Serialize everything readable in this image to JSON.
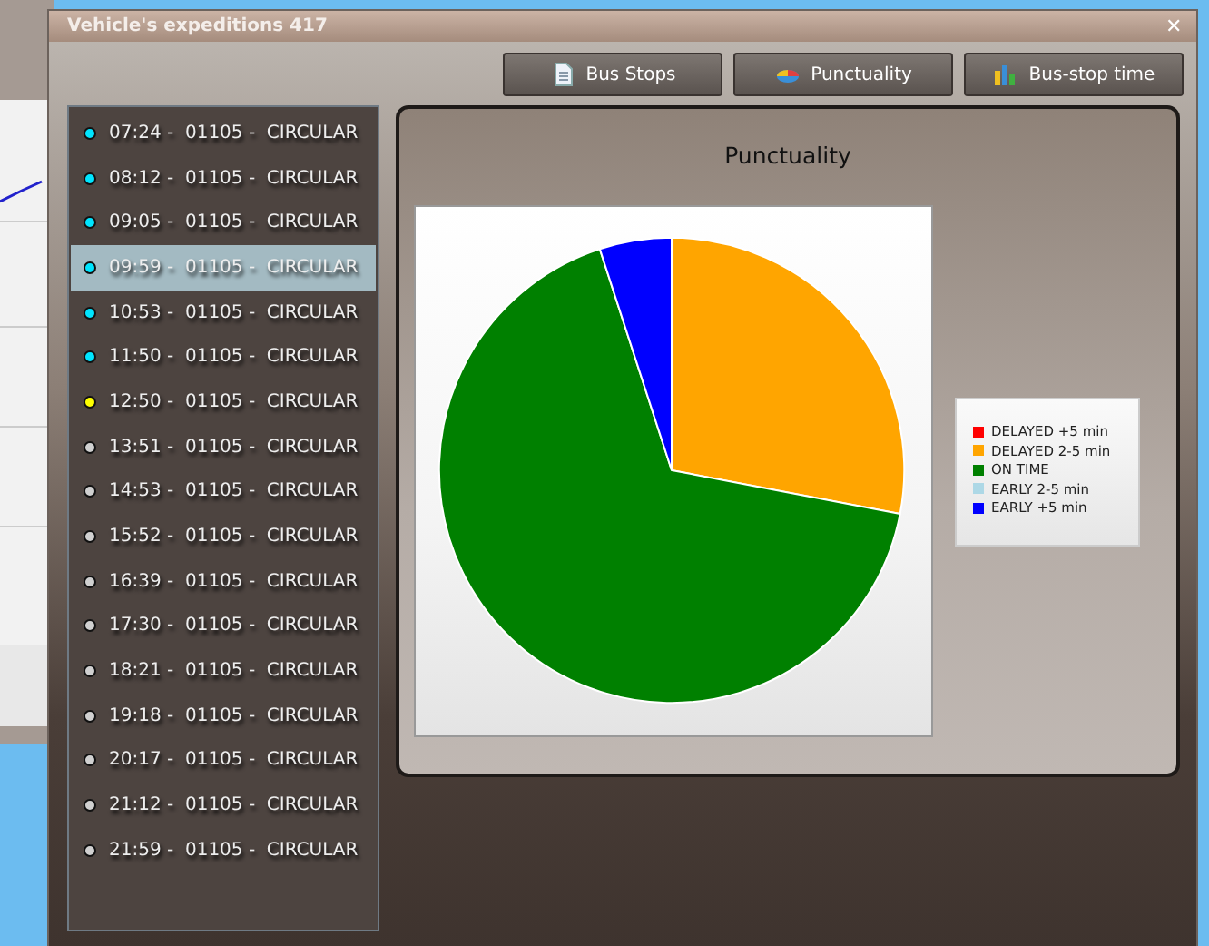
{
  "window": {
    "title": "Vehicle's expeditions 417",
    "close": "✕"
  },
  "buttons": [
    {
      "label": "Bus Stops",
      "kind": "document"
    },
    {
      "label": "Punctuality",
      "kind": "pie"
    },
    {
      "label": "Bus-stop time",
      "kind": "bars"
    }
  ],
  "expeditions": [
    {
      "label": "07:24 -  01105 -  CIRCULAR",
      "color": "#00e5ff",
      "selected": false
    },
    {
      "label": "08:12 -  01105 -  CIRCULAR",
      "color": "#00e5ff",
      "selected": false
    },
    {
      "label": "09:05 -  01105 -  CIRCULAR",
      "color": "#00e5ff",
      "selected": false
    },
    {
      "label": "09:59 -  01105 -  CIRCULAR",
      "color": "#00e5ff",
      "selected": true
    },
    {
      "label": "10:53 -  01105 -  CIRCULAR",
      "color": "#00e5ff",
      "selected": false
    },
    {
      "label": "11:50 -  01105 -  CIRCULAR",
      "color": "#00e5ff",
      "selected": false
    },
    {
      "label": "12:50 -  01105 -  CIRCULAR",
      "color": "#ffff00",
      "selected": false
    },
    {
      "label": "13:51 -  01105 -  CIRCULAR",
      "color": "#d0d0d0",
      "selected": false
    },
    {
      "label": "14:53 -  01105 -  CIRCULAR",
      "color": "#d0d0d0",
      "selected": false
    },
    {
      "label": "15:52 -  01105 -  CIRCULAR",
      "color": "#d0d0d0",
      "selected": false
    },
    {
      "label": "16:39 -  01105 -  CIRCULAR",
      "color": "#d0d0d0",
      "selected": false
    },
    {
      "label": "17:30 -  01105 -  CIRCULAR",
      "color": "#d0d0d0",
      "selected": false
    },
    {
      "label": "18:21 -  01105 -  CIRCULAR",
      "color": "#d0d0d0",
      "selected": false
    },
    {
      "label": "19:18 -  01105 -  CIRCULAR",
      "color": "#d0d0d0",
      "selected": false
    },
    {
      "label": "20:17 -  01105 -  CIRCULAR",
      "color": "#d0d0d0",
      "selected": false
    },
    {
      "label": "21:12 -  01105 -  CIRCULAR",
      "color": "#d0d0d0",
      "selected": false
    },
    {
      "label": "21:59 -  01105 -  CIRCULAR",
      "color": "#d0d0d0",
      "selected": false
    }
  ],
  "chart_data": {
    "type": "pie",
    "title": "Punctuality",
    "categories": [
      "DELAYED +5 min",
      "DELAYED 2-5 min",
      "ON TIME",
      "EARLY 2-5 min",
      "EARLY +5 min"
    ],
    "legend": true,
    "series": [
      {
        "color": [
          "#ff0000",
          "#ffa500",
          "#008000",
          "#add8e6",
          "#0000ff"
        ],
        "values": [
          0,
          0.28,
          0.67,
          0,
          0.05
        ]
      }
    ]
  }
}
